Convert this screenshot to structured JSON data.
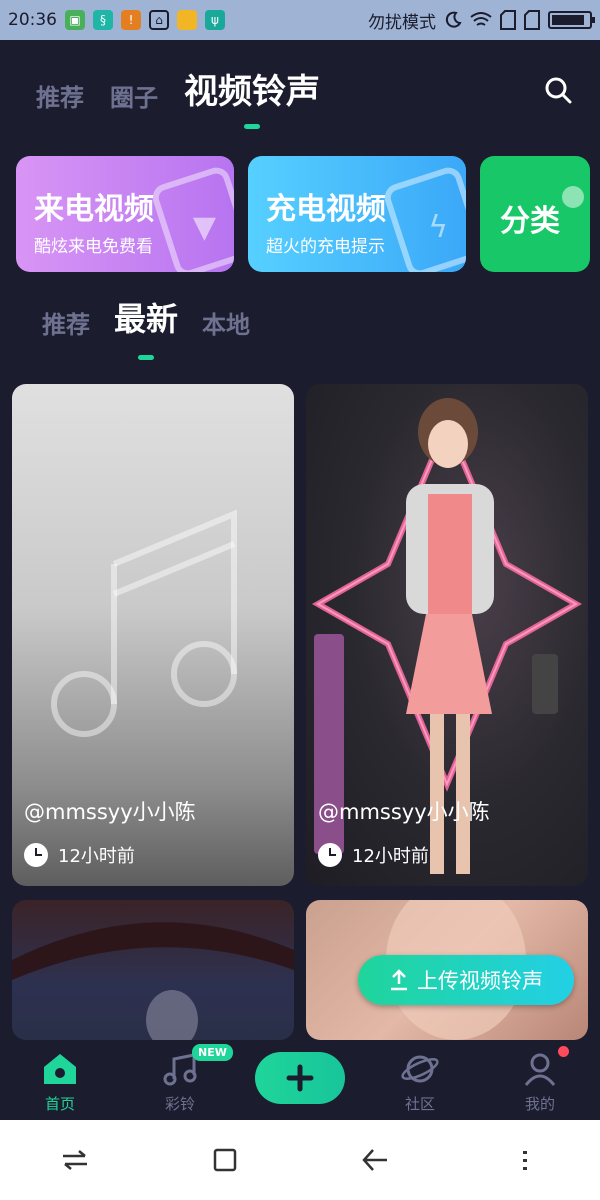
{
  "status_bar": {
    "time": "20:36",
    "dnd_text": "勿扰模式",
    "battery_percent": 90,
    "left_icons": [
      "green-app-icon",
      "teal-app-icon",
      "warning-icon",
      "brush-icon",
      "folder-icon",
      "usb-icon"
    ],
    "right_icons": [
      "moon-icon",
      "wifi-icon",
      "sim1-icon",
      "sim2-icon",
      "battery-icon"
    ]
  },
  "top_tabs": {
    "items": [
      "推荐",
      "圈子",
      "视频铃声"
    ],
    "active_index": 2,
    "search_icon": "search-icon"
  },
  "category_cards": [
    {
      "title": "来电视频",
      "subtitle": "酷炫来电免费看",
      "color": "#c584f3",
      "icon": "phone-icon"
    },
    {
      "title": "充电视频",
      "subtitle": "超火的充电提示",
      "color": "#47bdfb",
      "icon": "battery-bolt-icon"
    },
    {
      "title": "分类",
      "subtitle": "",
      "color": "#18c767",
      "icon": "category-icon"
    }
  ],
  "sub_tabs": {
    "items": [
      "推荐",
      "最新",
      "本地"
    ],
    "active_index": 1
  },
  "videos": [
    {
      "author": "@mmssyy小小陈",
      "time": "12小时前"
    },
    {
      "author": "@mmssyy小小陈",
      "time": "12小时前"
    }
  ],
  "upload_button": {
    "label": "上传视频铃声",
    "icon": "upload-icon"
  },
  "bottom_nav": {
    "items": [
      {
        "label": "首页",
        "icon": "home-icon",
        "active": true
      },
      {
        "label": "彩铃",
        "icon": "music-icon",
        "badge": "NEW"
      },
      {
        "label": "",
        "icon": "plus-icon"
      },
      {
        "label": "社区",
        "icon": "planet-icon"
      },
      {
        "label": "我的",
        "icon": "profile-icon",
        "dot": true
      }
    ]
  },
  "accent_color": "#1fd59a"
}
